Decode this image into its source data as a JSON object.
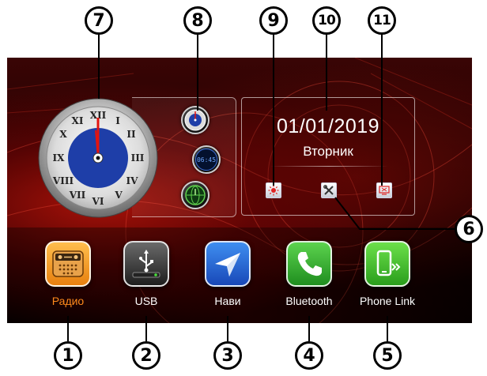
{
  "date": "01/01/2019",
  "weekday": "Вторник",
  "digital_clock_preview": "06:45",
  "apps": [
    {
      "label": "Радио",
      "icon": "radio-icon",
      "active": true
    },
    {
      "label": "USB",
      "icon": "usb-icon",
      "active": false
    },
    {
      "label": "Нави",
      "icon": "navigation-arrow-icon",
      "active": false
    },
    {
      "label": "Bluetooth",
      "icon": "phone-handset-icon",
      "active": false
    },
    {
      "label": "Phone  Link",
      "icon": "phone-link-icon",
      "active": false
    }
  ],
  "panel_buttons": [
    "brightness-icon",
    "tools-icon",
    "screen-off-icon"
  ],
  "clock_styles": [
    "analog-clock-style-icon",
    "digital-clock-style-icon",
    "globe-clock-style-icon"
  ],
  "callouts": {
    "c1": "1",
    "c2": "2",
    "c3": "3",
    "c4": "4",
    "c5": "5",
    "c6": "6",
    "c7": "7",
    "c8": "8",
    "c9": "9",
    "c10": "10",
    "c11": "11"
  },
  "colors": {
    "active_label": "#ff8a1c",
    "radio_icon": "#f39a1c",
    "usb_icon": "#3b3b3b",
    "nav_icon": "#1f64d6",
    "bluetooth_icon": "#2fae2f",
    "phonelink_icon": "#3cbb28",
    "clock_face": "#1e3ea8",
    "clock_hand": "#e4140f"
  }
}
